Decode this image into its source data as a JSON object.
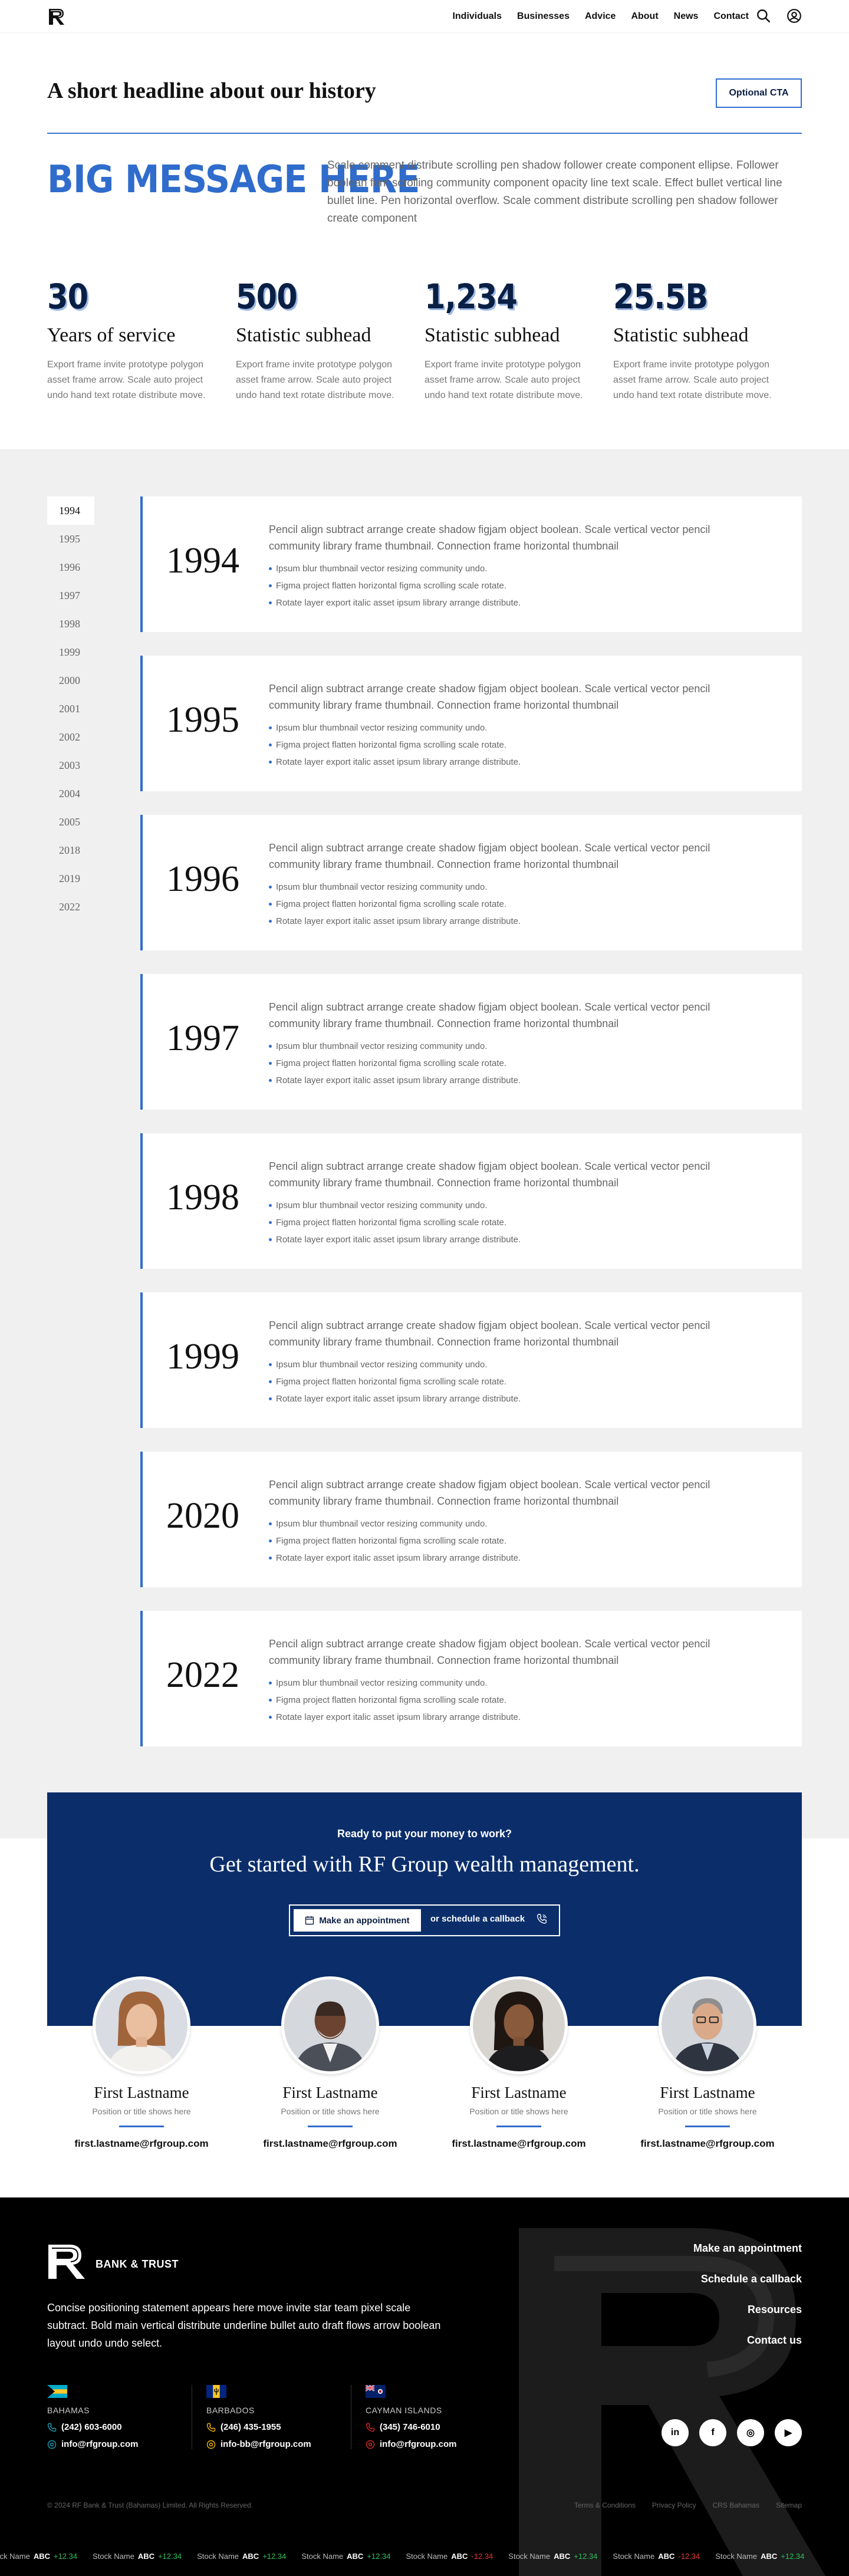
{
  "nav": {
    "links": [
      "Individuals",
      "Businesses",
      "Advice",
      "About",
      "News",
      "Contact"
    ],
    "icons": [
      "search-icon",
      "user-icon"
    ]
  },
  "intro": {
    "headline": "A short headline about our history",
    "cta_label": "Optional CTA",
    "big_message": "BIG MESSAGE HERE",
    "paragraph": "Scale comment distribute scrolling pen shadow follower create component ellipse. Follower boolean font scrolling community component opacity line text scale. Effect bullet vertical line bullet line. Pen horizontal overflow. Scale comment distribute scrolling pen shadow follower create component"
  },
  "stats": [
    {
      "number": "30",
      "subhead": "Years of service",
      "desc": "Export frame invite prototype polygon asset frame arrow. Scale auto project undo hand text rotate distribute move."
    },
    {
      "number": "500",
      "subhead": "Statistic subhead",
      "desc": "Export frame invite prototype polygon asset frame arrow. Scale auto project undo hand text rotate distribute move."
    },
    {
      "number": "1,234",
      "subhead": "Statistic subhead",
      "desc": "Export frame invite prototype polygon asset frame arrow. Scale auto project undo hand text rotate distribute move."
    },
    {
      "number": "25.5B",
      "subhead": "Statistic subhead",
      "desc": "Export frame invite prototype polygon asset frame arrow. Scale auto project undo hand text rotate distribute move."
    }
  ],
  "timeline": {
    "years": [
      "1994",
      "1995",
      "1996",
      "1997",
      "1998",
      "1999",
      "2000",
      "2001",
      "2002",
      "2003",
      "2004",
      "2005",
      "2018",
      "2019",
      "2022"
    ],
    "active_year": "1994",
    "entries": [
      {
        "year": "1994",
        "text": "Pencil align subtract arrange create shadow figjam object boolean. Scale vertical vector pencil community library frame thumbnail. Connection frame horizontal thumbnail",
        "bullets": [
          "Ipsum blur thumbnail vector resizing community undo.",
          "Figma project flatten horizontal figma scrolling scale rotate.",
          "Rotate layer export italic asset ipsum library arrange distribute."
        ]
      },
      {
        "year": "1995",
        "text": "Pencil align subtract arrange create shadow figjam object boolean. Scale vertical vector pencil community library frame thumbnail. Connection frame horizontal thumbnail",
        "bullets": [
          "Ipsum blur thumbnail vector resizing community undo.",
          "Figma project flatten horizontal figma scrolling scale rotate.",
          "Rotate layer export italic asset ipsum library arrange distribute."
        ]
      },
      {
        "year": "1996",
        "text": "Pencil align subtract arrange create shadow figjam object boolean. Scale vertical vector pencil community library frame thumbnail. Connection frame horizontal thumbnail",
        "bullets": [
          "Ipsum blur thumbnail vector resizing community undo.",
          "Figma project flatten horizontal figma scrolling scale rotate.",
          "Rotate layer export italic asset ipsum library arrange distribute."
        ]
      },
      {
        "year": "1997",
        "text": "Pencil align subtract arrange create shadow figjam object boolean. Scale vertical vector pencil community library frame thumbnail. Connection frame horizontal thumbnail",
        "bullets": [
          "Ipsum blur thumbnail vector resizing community undo.",
          "Figma project flatten horizontal figma scrolling scale rotate.",
          "Rotate layer export italic asset ipsum library arrange distribute."
        ]
      },
      {
        "year": "1998",
        "text": "Pencil align subtract arrange create shadow figjam object boolean. Scale vertical vector pencil community library frame thumbnail. Connection frame horizontal thumbnail",
        "bullets": [
          "Ipsum blur thumbnail vector resizing community undo.",
          "Figma project flatten horizontal figma scrolling scale rotate.",
          "Rotate layer export italic asset ipsum library arrange distribute."
        ]
      },
      {
        "year": "1999",
        "text": "Pencil align subtract arrange create shadow figjam object boolean. Scale vertical vector pencil community library frame thumbnail. Connection frame horizontal thumbnail",
        "bullets": [
          "Ipsum blur thumbnail vector resizing community undo.",
          "Figma project flatten horizontal figma scrolling scale rotate.",
          "Rotate layer export italic asset ipsum library arrange distribute."
        ]
      },
      {
        "year": "2020",
        "text": "Pencil align subtract arrange create shadow figjam object boolean. Scale vertical vector pencil community library frame thumbnail. Connection frame horizontal thumbnail",
        "bullets": [
          "Ipsum blur thumbnail vector resizing community undo.",
          "Figma project flatten horizontal figma scrolling scale rotate.",
          "Rotate layer export italic asset ipsum library arrange distribute."
        ]
      },
      {
        "year": "2022",
        "text": "Pencil align subtract arrange create shadow figjam object boolean. Scale vertical vector pencil community library frame thumbnail. Connection frame horizontal thumbnail",
        "bullets": [
          "Ipsum blur thumbnail vector resizing community undo.",
          "Figma project flatten horizontal figma scrolling scale rotate.",
          "Rotate layer export italic asset ipsum library arrange distribute."
        ]
      }
    ]
  },
  "cta": {
    "kicker": "Ready to put your money to work?",
    "title": "Get started with RF Group wealth management.",
    "appointment_label": "Make an appointment",
    "callback_label": "or schedule a callback"
  },
  "team": [
    {
      "name": "First Lastname",
      "title": "Position or title shows here",
      "email": "first.lastname@rfgroup.com"
    },
    {
      "name": "First Lastname",
      "title": "Position or title shows here",
      "email": "first.lastname@rfgroup.com"
    },
    {
      "name": "First Lastname",
      "title": "Position or title shows here",
      "email": "first.lastname@rfgroup.com"
    },
    {
      "name": "First Lastname",
      "title": "Position or title shows here",
      "email": "first.lastname@rfgroup.com"
    }
  ],
  "footer": {
    "brand": "BANK & TRUST",
    "statement": "Concise positioning statement appears here move invite star team pixel scale subtract. Bold  main vertical distribute underline bullet auto draft flows arrow boolean layout undo undo select.",
    "links": [
      "Make an appointment",
      "Schedule a callback",
      "Resources",
      "Contact us"
    ],
    "offices": [
      {
        "name": "BAHAMAS",
        "phone": "(242) 603-6000",
        "email": "info@rfgroup.com",
        "accent": "#1aa0b8"
      },
      {
        "name": "BARBADOS",
        "phone": "(246) 435-1955",
        "email": "info-bb@rfgroup.com",
        "accent": "#f2b400"
      },
      {
        "name": "CAYMAN ISLANDS",
        "phone": "(345) 746-6010",
        "email": "info@rfgroup.com",
        "accent": "#d62828"
      }
    ],
    "socials": [
      "in",
      "f",
      "◎",
      "▶"
    ],
    "copyright": "© 2024 RF Bank & Trust (Bahamas) Limited. All Rights Reserved.",
    "legal": [
      "Terms & Conditions",
      "Privacy Policy",
      "CRS Bahamas",
      "Sitemap"
    ],
    "ticker": [
      {
        "name": "Stock Name",
        "code": "ABC",
        "change": "+12.34",
        "dir": "up"
      },
      {
        "name": "Stock Name",
        "code": "ABC",
        "change": "+12.34",
        "dir": "up"
      },
      {
        "name": "Stock Name",
        "code": "ABC",
        "change": "+12.34",
        "dir": "up"
      },
      {
        "name": "Stock Name",
        "code": "ABC",
        "change": "+12.34",
        "dir": "up"
      },
      {
        "name": "Stock Name",
        "code": "ABC",
        "change": "-12.34",
        "dir": "down"
      },
      {
        "name": "Stock Name",
        "code": "ABC",
        "change": "+12.34",
        "dir": "up"
      },
      {
        "name": "Stock Name",
        "code": "ABC",
        "change": "-12.34",
        "dir": "down"
      },
      {
        "name": "Stock Name",
        "code": "ABC",
        "change": "+12.34",
        "dir": "up"
      }
    ]
  },
  "colors": {
    "accent": "#2f6ccc",
    "navy": "#0b2e6b",
    "up": "#2ec35a",
    "down": "#e53935"
  }
}
